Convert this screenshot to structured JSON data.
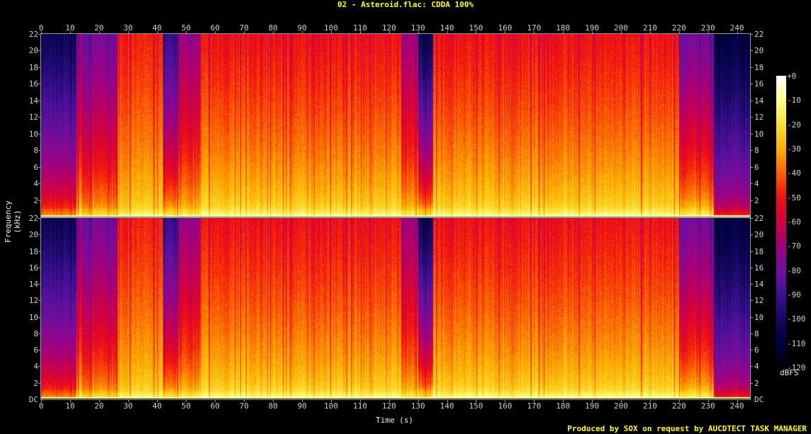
{
  "title": "02 - Asteroid.flac: CDDA 100%",
  "footer": "Produced by SOX on request by AUCDTECT TASK MANAGER",
  "chart_data": {
    "type": "heatmap",
    "title": "02 - Asteroid.flac: CDDA 100%",
    "xlabel": "Time (s)",
    "ylabel": "Frequency (kHz)",
    "xlim": [
      0,
      244.5
    ],
    "ylim_khz": [
      0,
      22
    ],
    "x_ticks": [
      0,
      10,
      20,
      30,
      40,
      50,
      60,
      70,
      80,
      90,
      100,
      110,
      120,
      130,
      140,
      150,
      160,
      170,
      180,
      190,
      200,
      210,
      220,
      230,
      240
    ],
    "y_ticks": [
      "22",
      "20",
      "18",
      "16",
      "14",
      "12",
      "10",
      "8",
      "6",
      "4",
      "2"
    ],
    "bottom_label": "DC",
    "channels": [
      "left",
      "right"
    ],
    "colorbar": {
      "unit": "dBFS",
      "ticks": [
        "+0",
        "-10",
        "-20",
        "-30",
        "-40",
        "-50",
        "-60",
        "-70",
        "-80",
        "-90",
        "-100",
        "-110",
        "-120"
      ],
      "range_db": [
        -120,
        0
      ]
    },
    "segments_db": [
      {
        "start": 0,
        "end": 12,
        "db_at_22k": -105,
        "db_at_1k": -45
      },
      {
        "start": 12,
        "end": 14,
        "db_at_22k": -75,
        "db_at_1k": -25
      },
      {
        "start": 14,
        "end": 26,
        "db_at_22k": -80,
        "db_at_1k": -30
      },
      {
        "start": 26,
        "end": 42,
        "db_at_22k": -50,
        "db_at_1k": -22
      },
      {
        "start": 42,
        "end": 47,
        "db_at_22k": -95,
        "db_at_1k": -30
      },
      {
        "start": 47,
        "end": 55,
        "db_at_22k": -72,
        "db_at_1k": -25
      },
      {
        "start": 55,
        "end": 124,
        "db_at_22k": -52,
        "db_at_1k": -20
      },
      {
        "start": 124,
        "end": 130,
        "db_at_22k": -70,
        "db_at_1k": -25
      },
      {
        "start": 130,
        "end": 135,
        "db_at_22k": -105,
        "db_at_1k": -30
      },
      {
        "start": 135,
        "end": 164,
        "db_at_22k": -52,
        "db_at_1k": -20
      },
      {
        "start": 164,
        "end": 220,
        "db_at_22k": -52,
        "db_at_1k": -20
      },
      {
        "start": 220,
        "end": 232,
        "db_at_22k": -80,
        "db_at_1k": -25
      },
      {
        "start": 232,
        "end": 244.5,
        "db_at_22k": -110,
        "db_at_1k": -60
      }
    ]
  }
}
